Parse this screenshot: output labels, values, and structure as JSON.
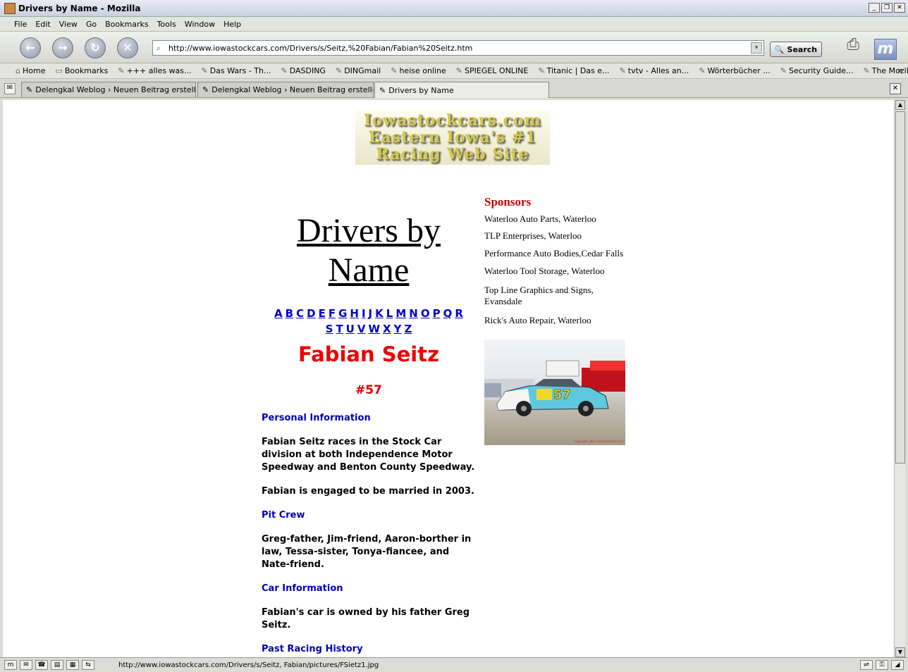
{
  "window": {
    "title": "Drivers by Name - Mozilla"
  },
  "menu": [
    "File",
    "Edit",
    "View",
    "Go",
    "Bookmarks",
    "Tools",
    "Window",
    "Help"
  ],
  "nav": {
    "url": "http://www.iowastockcars.com/Drivers/s/Seitz,%20Fabian/Fabian%20Seitz.htm",
    "search_label": "Search"
  },
  "bookmarks": [
    "Home",
    "Bookmarks",
    "+++ alles was...",
    "Das Wars - Th...",
    "DASDING",
    "DINGmail",
    "heise online",
    "SPIEGEL ONLINE",
    "Titanic | Das e...",
    "tvtv - Alles an...",
    "Wörterbücher ...",
    "Security Guide...",
    "The Mozilla Or..."
  ],
  "bookmarks_more": "»",
  "tabs": [
    {
      "label": "Delengkal Weblog › Neuen Beitrag erstellen..."
    },
    {
      "label": "Delengkal Weblog › Neuen Beitrag erstellen..."
    },
    {
      "label": "Drivers by Name"
    }
  ],
  "page": {
    "logo": [
      "Iowastockcars.com",
      "Eastern Iowa's #1",
      "Racing Web Site"
    ],
    "title_line1": "Drivers by",
    "title_line2": "Name",
    "letters_row1": [
      "A",
      "B",
      "C",
      "D",
      "E",
      "F",
      "G",
      "H",
      "I",
      "J",
      "K",
      "L",
      "M",
      "N",
      "O",
      "P",
      "Q",
      "R"
    ],
    "letters_row2": [
      "S",
      "T",
      "U",
      "V",
      "W",
      "X",
      "Y",
      "Z"
    ],
    "driver_name": "Fabian Seitz",
    "car_number": "#57",
    "personal_heading": "Personal Information",
    "personal_text1": "Fabian Seitz races in the Stock Car division at both Independence Motor Speedway and Benton County Speedway.",
    "personal_text2": "Fabian is engaged to be married in 2003.",
    "pit_heading": "Pit Crew",
    "pit_text": "Greg-father, Jim-friend, Aaron-borther in law, Tessa-sister, Tonya-fiancee, and Nate-friend.",
    "car_heading": "Car Information",
    "car_text": "Fabian's car is owned by his father Greg Seitz.",
    "past_heading": "Past Racing History",
    "sponsors_heading": "Sponsors",
    "sponsors": [
      "Waterloo Auto Parts, Waterloo",
      "TLP Enterprises, Waterloo",
      "Performance Auto Bodies,Cedar Falls",
      "Waterloo Tool Storage, Waterloo",
      "Top Line Graphics and Signs, Evansdale",
      "Rick's Auto Repair, Waterloo"
    ],
    "photo_car_number": "57",
    "photo_caption": "copyright 2001 iowastockcars.com"
  },
  "status": {
    "url": "http://www.iowastockcars.com/Drivers/s/Seitz, Fabian/pictures/FSietz1.jpg"
  }
}
